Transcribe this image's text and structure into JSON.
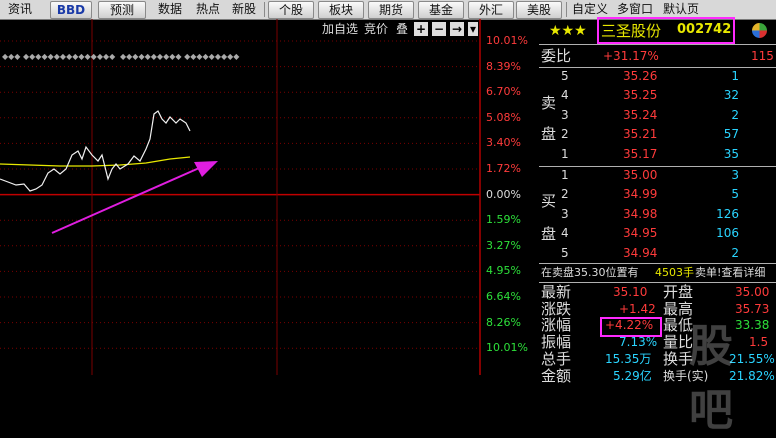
{
  "toolbar": {
    "items": [
      "资讯",
      "BBD",
      "预测",
      "数据",
      "热点",
      "新股",
      "个股",
      "板块",
      "期货",
      "基金",
      "外汇",
      "美股",
      "自定义",
      "多窗口",
      "默认页"
    ]
  },
  "chart": {
    "tools": [
      "加自选",
      "竞价",
      "叠"
    ],
    "tool_icons": [
      "plus-icon",
      "minus-icon",
      "arrow-right-icon",
      "dropdown-icon"
    ],
    "axis_pct": [
      "10.01%",
      "8.39%",
      "6.70%",
      "5.08%",
      "3.40%",
      "1.72%",
      "0.00%",
      "1.59%",
      "3.27%",
      "4.95%",
      "6.64%",
      "8.26%",
      "10.01%"
    ],
    "arrow_color": "#e01ee0"
  },
  "stock": {
    "name": "三圣股份",
    "code": "002742",
    "stars": "★★★"
  },
  "weibi": {
    "label": "委比",
    "pct": "+31.17%",
    "diff": "115"
  },
  "sell": {
    "label1": "卖",
    "label2": "盘",
    "rows": [
      {
        "n": "5",
        "price": "35.26",
        "vol": "1"
      },
      {
        "n": "4",
        "price": "35.25",
        "vol": "32"
      },
      {
        "n": "3",
        "price": "35.24",
        "vol": "2"
      },
      {
        "n": "2",
        "price": "35.21",
        "vol": "57"
      },
      {
        "n": "1",
        "price": "35.17",
        "vol": "35"
      }
    ]
  },
  "buy": {
    "label1": "买",
    "label2": "盘",
    "rows": [
      {
        "n": "1",
        "price": "35.00",
        "vol": "3"
      },
      {
        "n": "2",
        "price": "34.99",
        "vol": "5"
      },
      {
        "n": "3",
        "price": "34.98",
        "vol": "126"
      },
      {
        "n": "4",
        "price": "34.95",
        "vol": "106"
      },
      {
        "n": "5",
        "price": "34.94",
        "vol": "2"
      }
    ]
  },
  "notice": {
    "text": "在卖盘35.30位置有",
    "vol": "4503手",
    "tail": "卖单!查看详细"
  },
  "quote": {
    "latest_label": "最新",
    "latest": "35.10",
    "open_label": "开盘",
    "open": "35.00",
    "change_label": "涨跌",
    "change": "+1.42",
    "high_label": "最高",
    "high": "35.73",
    "pct_label": "涨幅",
    "pct": "+4.22%",
    "low_label": "最低",
    "low": "33.38",
    "amp_label": "振幅",
    "amp": "7.13%",
    "ratio_label": "量比",
    "ratio": "1.5",
    "total_label": "总手",
    "total": "15.35万",
    "turnover_label": "换手",
    "turnover": "21.55%",
    "amount_label": "金额",
    "amount": "5.29亿",
    "turnover2_label": "换手(实)",
    "turnover2": "21.82%"
  },
  "watermark": "股吧"
}
